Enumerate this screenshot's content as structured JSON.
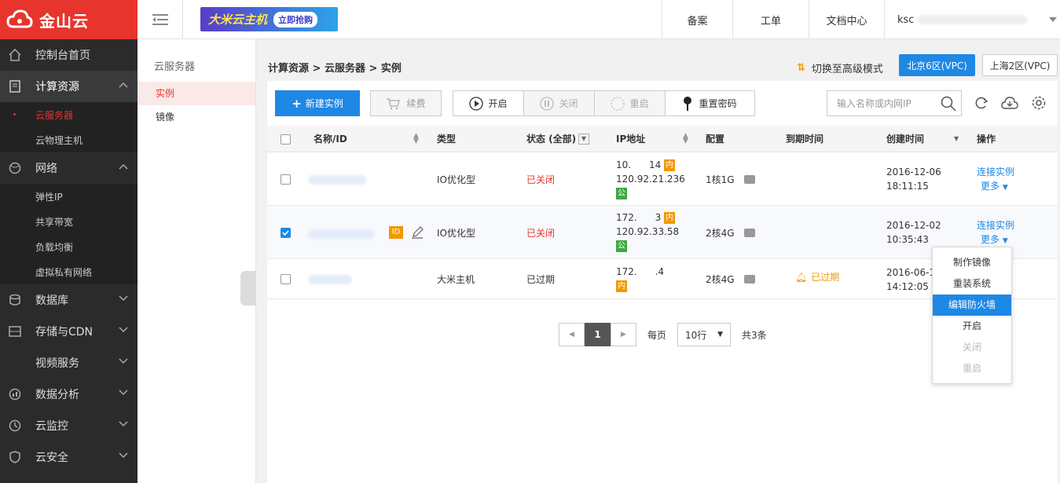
{
  "brand": {
    "name": "金山云"
  },
  "banner": {
    "text": "大米云主机",
    "button": "立即抢购"
  },
  "top_nav": {
    "links": [
      "备案",
      "工单",
      "文档中心"
    ],
    "user": "ksc"
  },
  "sidebar": {
    "items": [
      {
        "label": "控制台首页"
      },
      {
        "label": "计算资源",
        "subs": [
          "云服务器",
          "云物理主机"
        ]
      },
      {
        "label": "网络",
        "subs": [
          "弹性IP",
          "共享带宽",
          "负载均衡",
          "虚拟私有网络"
        ]
      },
      {
        "label": "数据库"
      },
      {
        "label": "存储与CDN"
      },
      {
        "label": "视频服务"
      },
      {
        "label": "数据分析"
      },
      {
        "label": "云监控"
      },
      {
        "label": "云安全"
      }
    ]
  },
  "subnav": {
    "title": "云服务器",
    "items": [
      "实例",
      "镜像"
    ]
  },
  "breadcrumb": "计算资源 > 云服务器 > 实例",
  "switch_advanced": "切换至高级模式",
  "regions": [
    "北京6区(VPC)",
    "上海2区(VPC)"
  ],
  "toolbar": {
    "create": "新建实例",
    "renew": "续费",
    "start": "开启",
    "stop": "关闭",
    "restart": "重启",
    "reset_pwd": "重置密码",
    "search_placeholder": "输入名称或内网IP"
  },
  "table": {
    "headers": [
      "名称/ID",
      "类型",
      "状态 (全部)",
      "IP地址",
      "配置",
      "到期时间",
      "创建时间",
      "操作"
    ],
    "rows": [
      {
        "type": "IO优化型",
        "status": "已关闭",
        "ip1": "10.      14",
        "ip2": "120.92.21.236",
        "config": "1核1G",
        "expire": "",
        "created": [
          "2016-12-06",
          "18:11:15"
        ],
        "action": "连接实例",
        "more": "更多"
      },
      {
        "type": "IO优化型",
        "status": "已关闭",
        "ip1": "172.      3",
        "ip2": "120.92.33.58",
        "config": "2核4G",
        "expire": "",
        "created": [
          "2016-12-02",
          "10:35:43"
        ],
        "action": "连接实例",
        "more": "更多",
        "id_badge": "ID"
      },
      {
        "type": "大米主机",
        "status": "已过期",
        "ip1": "172.      .4",
        "ip2": "",
        "config": "2核4G",
        "expire": "已过期",
        "created": [
          "2016-06-1",
          "14:12:05"
        ],
        "action": "",
        "more": ""
      }
    ],
    "tag_in": "内",
    "tag_pub": "公"
  },
  "dropdown": [
    "制作镜像",
    "重装系统",
    "编辑防火墙",
    "开启",
    "关闭",
    "重启"
  ],
  "pager": {
    "current": "1",
    "per_page_label": "每页",
    "per_page": "10行",
    "total": "共3条"
  },
  "colors": {
    "brand_red": "#e7352d",
    "primary_blue": "#1e88e5",
    "tag_orange": "#f39800",
    "tag_green": "#3ca940"
  }
}
